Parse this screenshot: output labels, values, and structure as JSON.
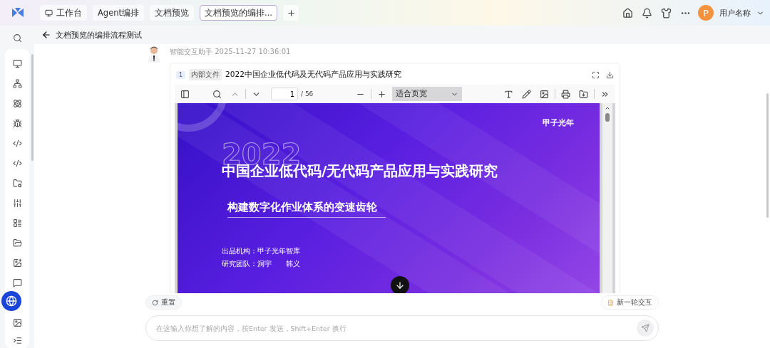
{
  "topbar": {
    "tabs": [
      {
        "label": "工作台",
        "kind": "home",
        "selected": false
      },
      {
        "label": "Agent编排",
        "kind": "page",
        "selected": false
      },
      {
        "label": "文档预览",
        "kind": "page",
        "selected": false
      },
      {
        "label": "文档预览的编排...",
        "kind": "page",
        "selected": true
      }
    ],
    "user": {
      "avatar_letter": "P",
      "name": "用户名称"
    }
  },
  "page": {
    "title": "文档预览的编排流程测试"
  },
  "message": {
    "sender": "智能交互助手",
    "time": "2025-11-27 10:36:01",
    "file": {
      "index": "1",
      "tag": "内部文件",
      "title": "2022中国企业低代码及无代码产品应用与实践研究"
    },
    "viewer": {
      "page": "1",
      "total": "/ 56",
      "zoom": "适合页宽"
    },
    "slide": {
      "brand": "甲子光年",
      "year": "2022",
      "title": "中国企业低代码/无代码产品应用与实践研究",
      "subtitle": "构建数字化作业体系的变速齿轮",
      "info": [
        "出品机构：甲子光年智库",
        "研究团队：洞宇　　韩义"
      ]
    }
  },
  "actions": {
    "reset": "重置",
    "new_round": "新一轮交互"
  },
  "composer": {
    "placeholder": "在这输入你想了解的内容，按Enter 发送，Shift+Enter 换行"
  }
}
